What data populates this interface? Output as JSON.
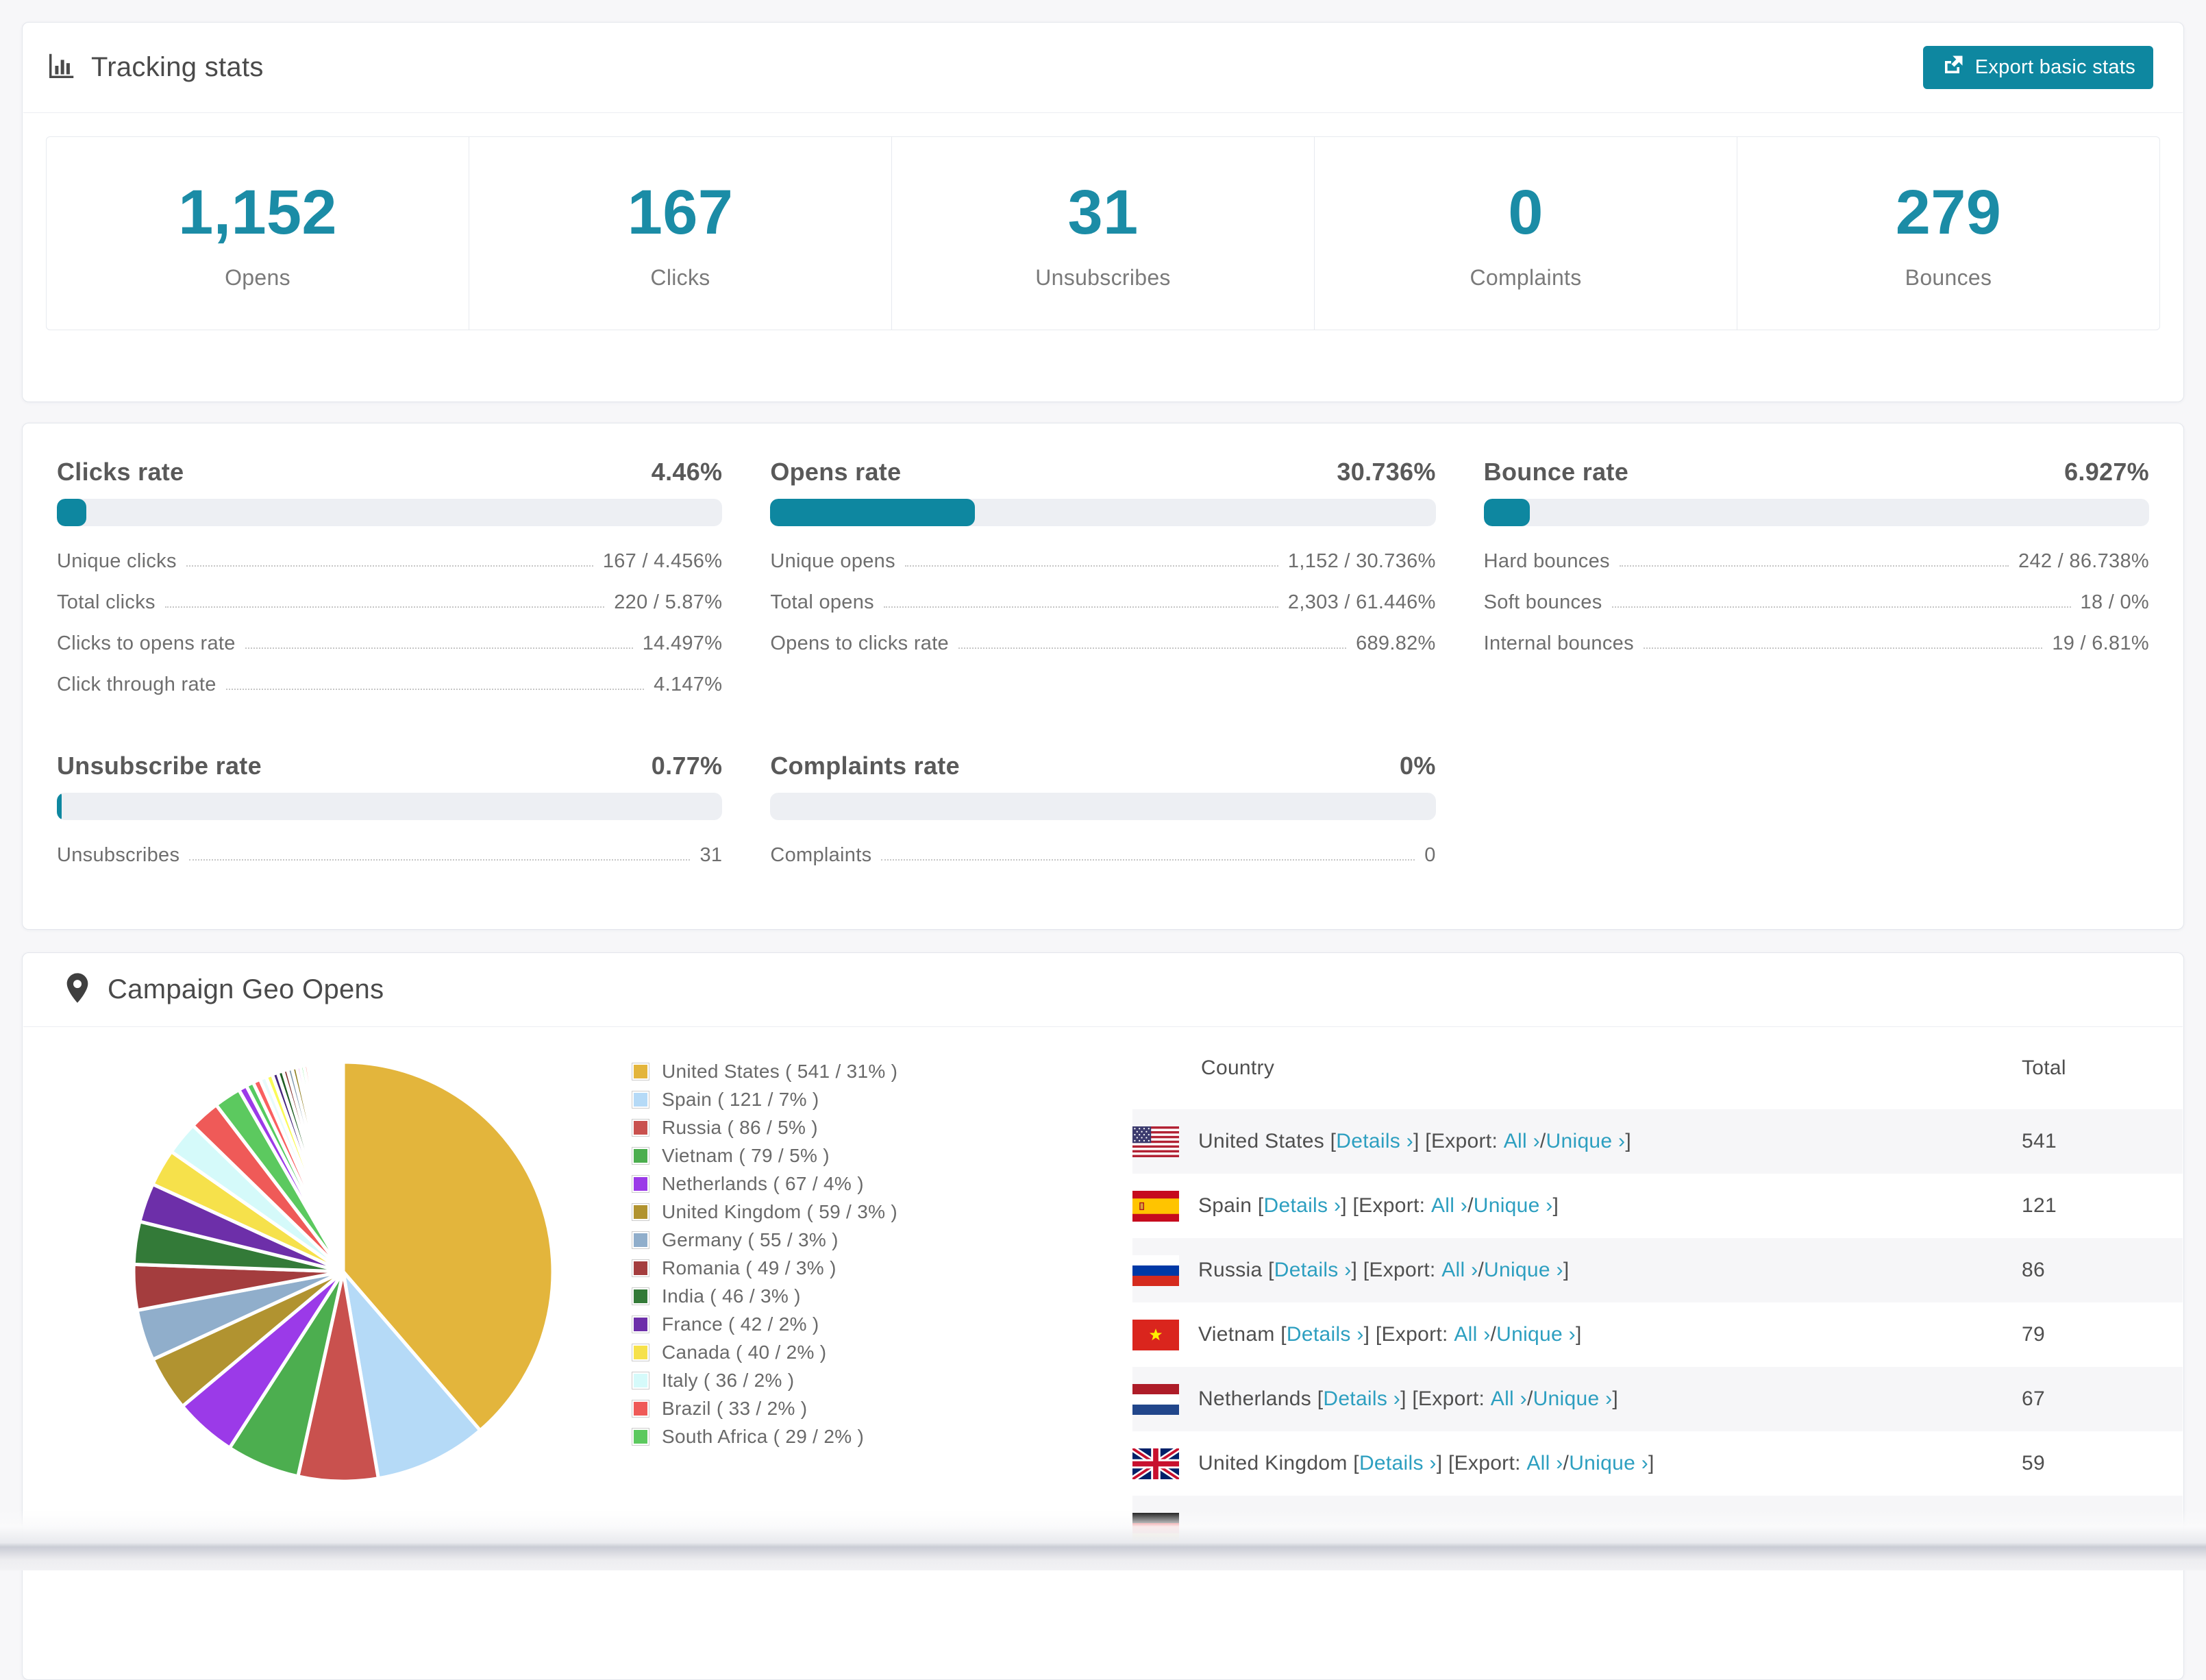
{
  "theme": {
    "accent": "#0e87a0",
    "stat_number_color": "#1b8ca6",
    "link_color": "#2d9fc0"
  },
  "tracking": {
    "title": "Tracking stats",
    "export_button": "Export basic stats"
  },
  "summary_stats": [
    {
      "value": "1,152",
      "label": "Opens"
    },
    {
      "value": "167",
      "label": "Clicks"
    },
    {
      "value": "31",
      "label": "Unsubscribes"
    },
    {
      "value": "0",
      "label": "Complaints"
    },
    {
      "value": "279",
      "label": "Bounces"
    }
  ],
  "rate_cards": [
    {
      "title": "Clicks rate",
      "value": "4.46%",
      "percent": 4.46,
      "rows": [
        {
          "label": "Unique clicks",
          "value": "167 / 4.456%"
        },
        {
          "label": "Total clicks",
          "value": "220 / 5.87%"
        },
        {
          "label": "Clicks to opens rate",
          "value": "14.497%"
        },
        {
          "label": "Click through rate",
          "value": "4.147%"
        }
      ]
    },
    {
      "title": "Opens rate",
      "value": "30.736%",
      "percent": 30.736,
      "rows": [
        {
          "label": "Unique opens",
          "value": "1,152 / 30.736%"
        },
        {
          "label": "Total opens",
          "value": "2,303 / 61.446%"
        },
        {
          "label": "Opens to clicks rate",
          "value": "689.82%"
        }
      ]
    },
    {
      "title": "Bounce rate",
      "value": "6.927%",
      "percent": 6.927,
      "rows": [
        {
          "label": "Hard bounces",
          "value": "242 / 86.738%"
        },
        {
          "label": "Soft bounces",
          "value": "18 / 0%"
        },
        {
          "label": "Internal bounces",
          "value": "19 / 6.81%"
        }
      ]
    },
    {
      "title": "Unsubscribe rate",
      "value": "0.77%",
      "percent": 0.77,
      "rows": [
        {
          "label": "Unsubscribes",
          "value": "31"
        }
      ]
    },
    {
      "title": "Complaints rate",
      "value": "0%",
      "percent": 0,
      "rows": [
        {
          "label": "Complaints",
          "value": "0"
        }
      ]
    }
  ],
  "geo": {
    "title": "Campaign Geo Opens",
    "table": {
      "columns": [
        "Country",
        "Total"
      ],
      "link_labels": {
        "details": "Details ›",
        "all": "All ›",
        "unique": "Unique ›",
        "export_prefix": "Export:",
        "open": "[",
        "close": "]",
        "slash": "/"
      },
      "rows": [
        {
          "flag": "us",
          "country": "United States",
          "total": "541"
        },
        {
          "flag": "es",
          "country": "Spain",
          "total": "121"
        },
        {
          "flag": "ru",
          "country": "Russia",
          "total": "86"
        },
        {
          "flag": "vn",
          "country": "Vietnam",
          "total": "79"
        },
        {
          "flag": "nl",
          "country": "Netherlands",
          "total": "67"
        },
        {
          "flag": "gb",
          "country": "United Kingdom",
          "total": "59"
        }
      ],
      "partial_row": {
        "flag": "de"
      }
    },
    "chart_data": {
      "type": "pie",
      "title": "Campaign Geo Opens",
      "legend_position": "right",
      "slices": [
        {
          "label": "United States",
          "value": 541,
          "pct": "31%",
          "color": "#e3b53c",
          "legend_label": "United States ( 541 / 31% )"
        },
        {
          "label": "Spain",
          "value": 121,
          "pct": "7%",
          "color": "#b5daf7",
          "legend_label": "Spain ( 121 / 7% )"
        },
        {
          "label": "Russia",
          "value": 86,
          "pct": "5%",
          "color": "#c9514e",
          "legend_label": "Russia ( 86 / 5% )"
        },
        {
          "label": "Vietnam",
          "value": 79,
          "pct": "5%",
          "color": "#4cae4f",
          "legend_label": "Vietnam ( 79 / 5% )"
        },
        {
          "label": "Netherlands",
          "value": 67,
          "pct": "4%",
          "color": "#9b3ae8",
          "legend_label": "Netherlands ( 67 / 4% )"
        },
        {
          "label": "United Kingdom",
          "value": 59,
          "pct": "3%",
          "color": "#b19330",
          "legend_label": "United Kingdom ( 59 / 3% )"
        },
        {
          "label": "Germany",
          "value": 55,
          "pct": "3%",
          "color": "#90aecb",
          "legend_label": "Germany ( 55 / 3% )"
        },
        {
          "label": "Romania",
          "value": 49,
          "pct": "3%",
          "color": "#a43d3e",
          "legend_label": "Romania ( 49 / 3% )"
        },
        {
          "label": "India",
          "value": 46,
          "pct": "3%",
          "color": "#337a38",
          "legend_label": "India ( 46 / 3% )"
        },
        {
          "label": "France",
          "value": 42,
          "pct": "2%",
          "color": "#6d2fa9",
          "legend_label": "France ( 42 / 2% )"
        },
        {
          "label": "Canada",
          "value": 40,
          "pct": "2%",
          "color": "#f6e14b",
          "legend_label": "Canada ( 40 / 2% )"
        },
        {
          "label": "Italy",
          "value": 36,
          "pct": "2%",
          "color": "#d5fafa",
          "legend_label": "Italy ( 36 / 2% )"
        },
        {
          "label": "Brazil",
          "value": 33,
          "pct": "2%",
          "color": "#ef5a58",
          "legend_label": "Brazil ( 33 / 2% )"
        },
        {
          "label": "South Africa",
          "value": 29,
          "pct": "2%",
          "color": "#5cc95f",
          "legend_label": "South Africa ( 29 / 2% )"
        }
      ],
      "others": {
        "note": "tail of small unlabeled country slices",
        "values": [
          9,
          8,
          8,
          7,
          7,
          6,
          6,
          5,
          5,
          5,
          4,
          4,
          4,
          3,
          3,
          3,
          3,
          2,
          2,
          2,
          2,
          2,
          2,
          2,
          1,
          1,
          1,
          1,
          1,
          1,
          1,
          1,
          1,
          1,
          1,
          1
        ],
        "colors": [
          "#9b3ae8",
          "#55ca60",
          "#f96060",
          "#e8fbfb",
          "#fbfb57",
          "#46257c",
          "#205e24",
          "#84302f",
          "#7e97ac",
          "#8f7d20",
          "#df52f2",
          "#63e878",
          "#fb7a72",
          "#f2fdff",
          "#f6f167",
          "#2c2460",
          "#14491c",
          "#6e2424",
          "#5c7a94",
          "#786a16",
          "#e06cf5",
          "#7df294",
          "#fa8181",
          "#bfe0f7",
          "#d8b940",
          "#d45452",
          "#57b957",
          "#8a4fe0",
          "#cfae35",
          "#a3cff2",
          "#e05a5a",
          "#6cd06c",
          "#b44fe8",
          "#c9a92e",
          "#f08ae8",
          "#d0d2f8"
        ]
      }
    }
  }
}
